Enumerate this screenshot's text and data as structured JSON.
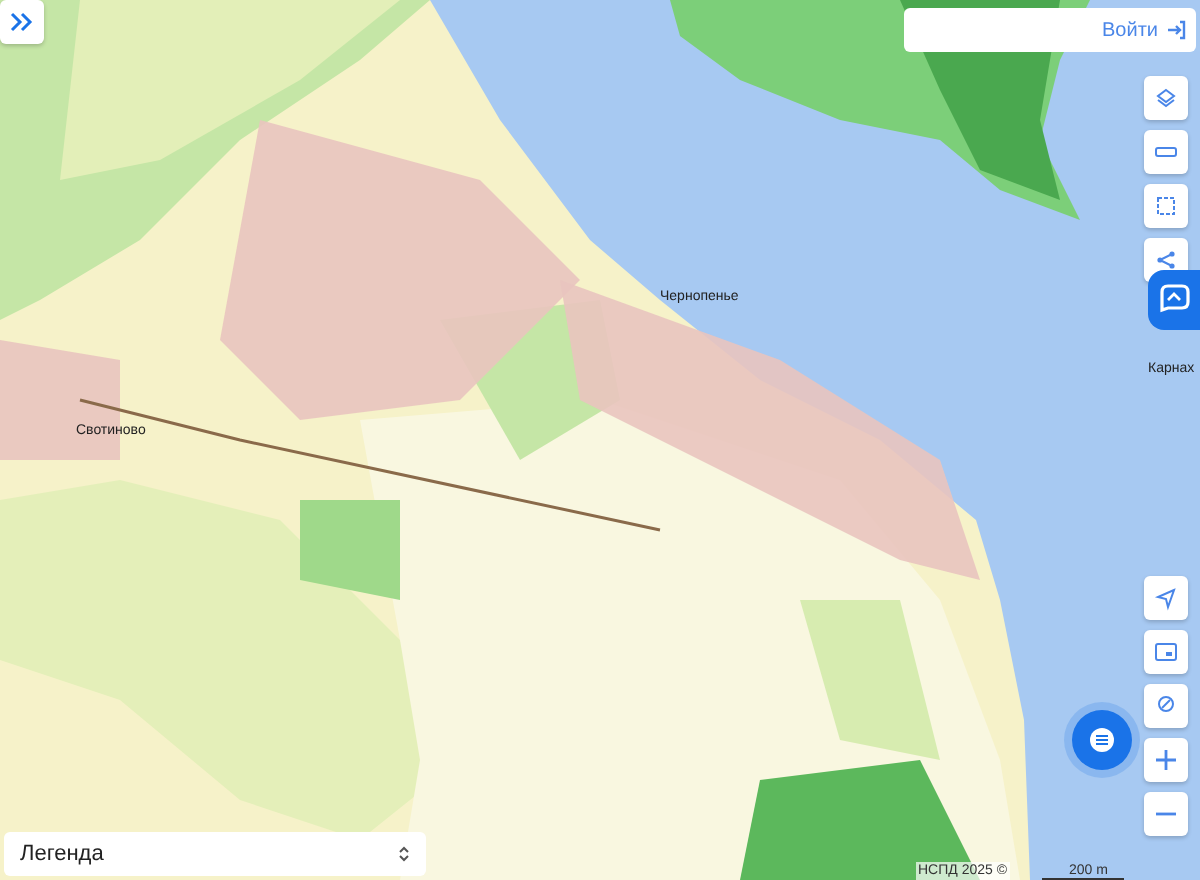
{
  "map": {
    "labels": [
      {
        "text": "Чернопенье",
        "kind": "village"
      },
      {
        "text": "Свотиново",
        "kind": "village"
      },
      {
        "text": "Карнах",
        "kind": "edge"
      }
    ],
    "attribution": "НСПД 2025 ©",
    "scale": "200 m"
  },
  "login": {
    "label": "Войти"
  },
  "legend": {
    "label": "Легенда"
  }
}
